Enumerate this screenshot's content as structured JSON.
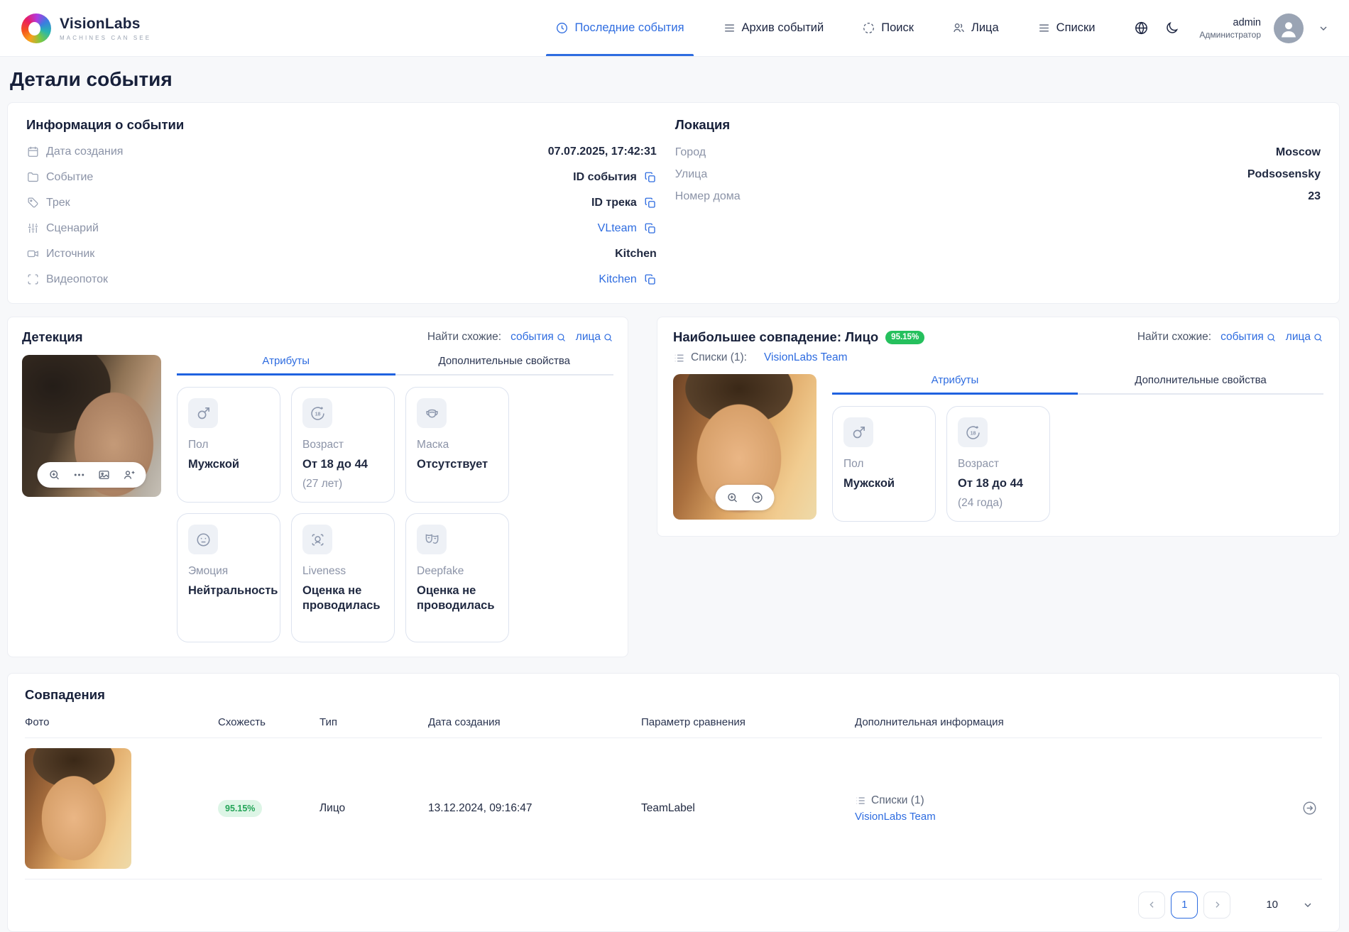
{
  "brand": {
    "name": "VisionLabs",
    "tagline": "MACHINES CAN SEE"
  },
  "nav": {
    "items": [
      {
        "label": "Последние события",
        "icon": "clock-icon",
        "active": true
      },
      {
        "label": "Архив событий",
        "icon": "list-icon",
        "active": false
      },
      {
        "label": "Поиск",
        "icon": "dashed-circle-icon",
        "active": false
      },
      {
        "label": "Лица",
        "icon": "people-icon",
        "active": false
      },
      {
        "label": "Списки",
        "icon": "list-icon",
        "active": false
      }
    ],
    "user": {
      "name": "admin",
      "role": "Администратор"
    }
  },
  "page_title": "Детали события",
  "event_info": {
    "title": "Информация о событии",
    "rows": [
      {
        "icon": "calendar-icon",
        "label": "Дата создания",
        "value": "07.07.2025, 17:42:31"
      },
      {
        "icon": "folder-icon",
        "label": "Событие",
        "value": "ID события"
      },
      {
        "icon": "tag-icon",
        "label": "Трек",
        "value": "ID трека"
      },
      {
        "icon": "sliders-icon",
        "label": "Сценарий",
        "value": "VLteam"
      },
      {
        "icon": "video-camera-icon",
        "label": "Источник",
        "value": "Kitchen"
      },
      {
        "icon": "scan-frame-icon",
        "label": "Видеопоток",
        "value": "Kitchen"
      }
    ]
  },
  "location": {
    "title": "Локация",
    "rows": [
      {
        "label": "Город",
        "value": "Moscow"
      },
      {
        "label": "Улица",
        "value": "Podsosensky"
      },
      {
        "label": "Номер дома",
        "value": "23"
      }
    ]
  },
  "detection": {
    "title": "Детекция",
    "find_similar": {
      "label": "Найти схожие:",
      "events_link": "события",
      "faces_link": "лица"
    },
    "tabs": [
      "Атрибуты",
      "Дополнительные свойства"
    ],
    "attributes": [
      {
        "icon": "male-icon",
        "label": "Пол",
        "value": "Мужской",
        "extra": ""
      },
      {
        "icon": "age-18-icon",
        "label": "Возраст",
        "value": "От 18 до 44",
        "extra": "(27 лет)"
      },
      {
        "icon": "mask-icon",
        "label": "Маска",
        "value": "Отсутствует",
        "extra": ""
      },
      {
        "icon": "emotion-icon",
        "label": "Эмоция",
        "value": "Нейтральность",
        "extra": ""
      },
      {
        "icon": "liveness-icon",
        "label": "Liveness",
        "value": "Оценка не проводилась",
        "extra": ""
      },
      {
        "icon": "deepfake-icon",
        "label": "Deepfake",
        "value": "Оценка не проводилась",
        "extra": ""
      }
    ]
  },
  "top_match": {
    "title": "Наибольшее совпадение: Лицо",
    "score": "95.15%",
    "lists_label": "Списки (1):",
    "lists_link": "VisionLabs Team",
    "find_similar": {
      "label": "Найти схожие:",
      "events_link": "события",
      "faces_link": "лица"
    },
    "tabs": [
      "Атрибуты",
      "Дополнительные свойства"
    ],
    "attributes": [
      {
        "icon": "male-icon",
        "label": "Пол",
        "value": "Мужской",
        "extra": ""
      },
      {
        "icon": "age-18-icon",
        "label": "Возраст",
        "value": "От 18 до 44",
        "extra": "(24 года)"
      }
    ]
  },
  "matches": {
    "title": "Совпадения",
    "columns": [
      "Фото",
      "Схожесть",
      "Тип",
      "Дата создания",
      "Параметр сравнения",
      "Дополнительная информация"
    ],
    "rows": [
      {
        "similarity": "95.15%",
        "type": "Лицо",
        "created": "13.12.2024, 09:16:47",
        "compare_param": "TeamLabel",
        "extra_label": "Списки (1)",
        "extra_link": "VisionLabs Team"
      }
    ],
    "pagination": {
      "page": "1",
      "page_size": "10"
    }
  },
  "colors": {
    "accent_blue": "#2e6ce0",
    "badge_green": "#25c05d",
    "badge_green_soft_bg": "#ddf5e6",
    "badge_green_soft_text": "#23a457"
  }
}
